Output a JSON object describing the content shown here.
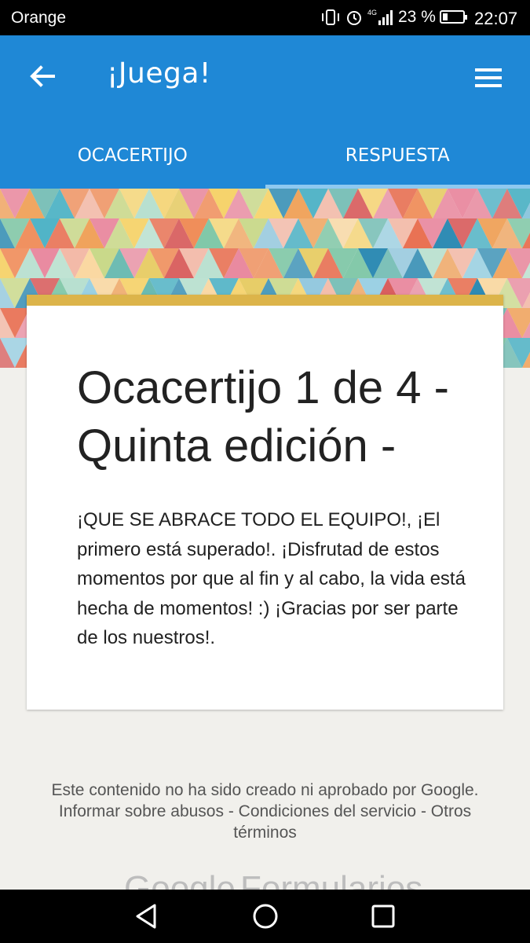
{
  "status_bar": {
    "carrier": "Orange",
    "network": "4G",
    "battery_percent": "23 %",
    "battery_level": 0.23,
    "time": "22:07",
    "icons": [
      "vibrate-icon",
      "alarm-icon",
      "signal-icon",
      "battery-icon"
    ]
  },
  "app_bar": {
    "title": "¡Juega!",
    "color": "#1f88d6",
    "back_icon": "arrow-left-icon",
    "menu_icon": "hamburger-menu-icon"
  },
  "tabs": [
    {
      "label": "OCACERTIJO",
      "active": false
    },
    {
      "label": "RESPUESTA",
      "active": true
    }
  ],
  "card": {
    "accent_color": "#dcb44a",
    "title": "Ocacertijo 1 de 4 - Quinta edición -",
    "body": "¡QUE SE ABRACE TODO EL EQUIPO!, ¡El primero está superado!. ¡Disfrutad de estos momentos por que al fin y al cabo, la vida está hecha de momentos! :) ¡Gracias por ser parte de los nuestros!."
  },
  "footer": {
    "disclaimer": "Este contenido no ha sido creado ni aprobado por Google.",
    "report_abuse": "Informar sobre abusos",
    "separator": " - ",
    "terms": "Condiciones del servicio",
    "other_terms": "Otros términos",
    "brand_a": "Google",
    "brand_b": "Formularios"
  },
  "nav_bar": {
    "icons": [
      "back-triangle-icon",
      "home-circle-icon",
      "recents-square-icon"
    ]
  }
}
